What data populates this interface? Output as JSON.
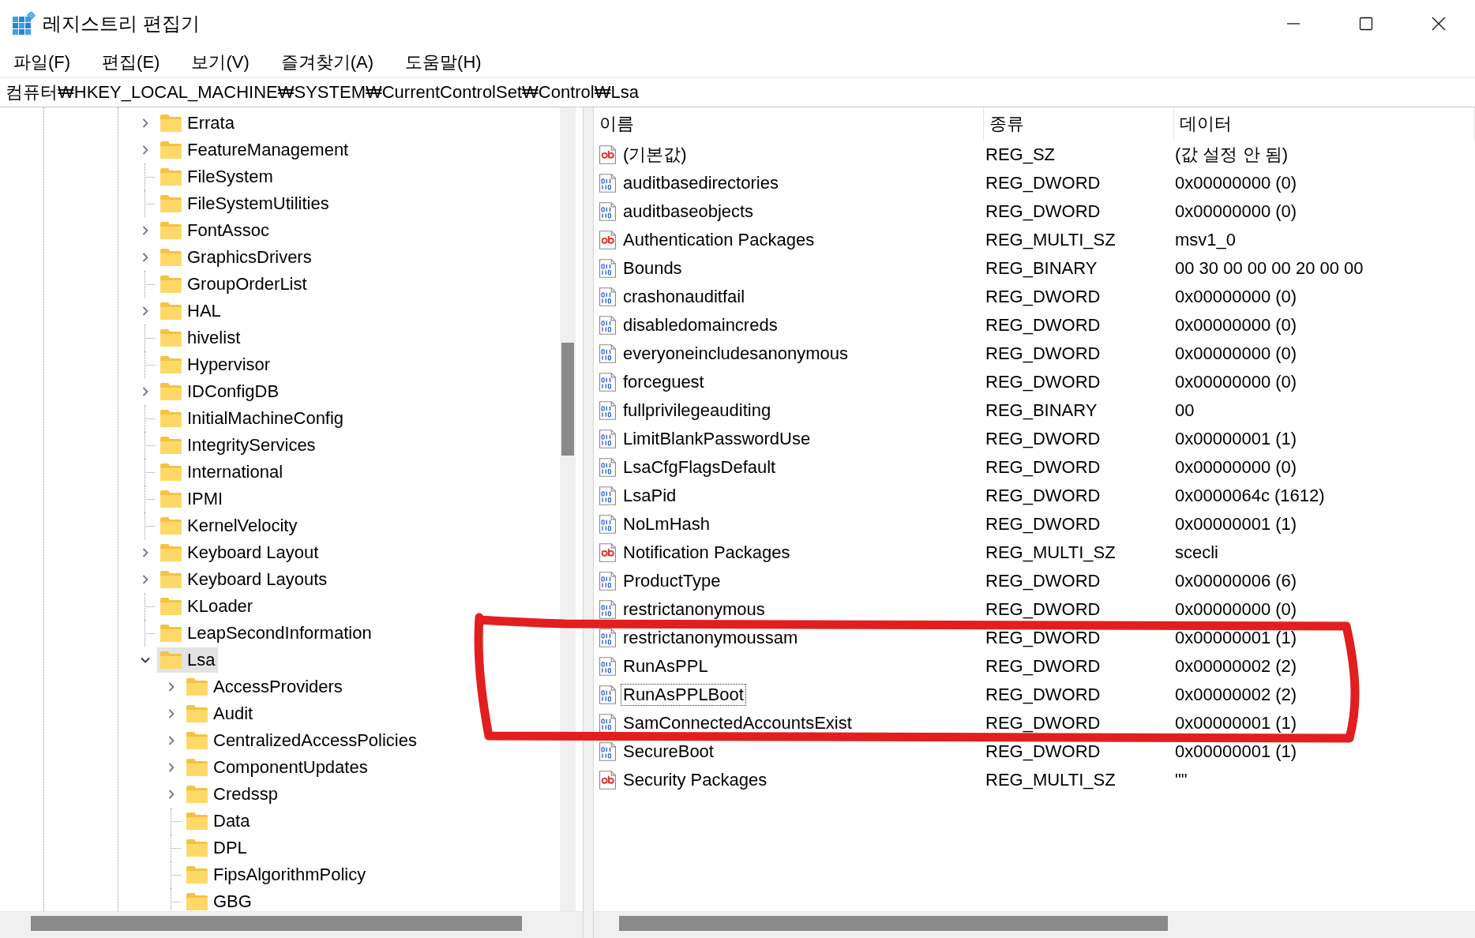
{
  "window": {
    "title": "레지스트리 편집기"
  },
  "menu": [
    "파일(F)",
    "편집(E)",
    "보기(V)",
    "즐겨찾기(A)",
    "도움말(H)"
  ],
  "address": "컴퓨터₩HKEY_LOCAL_MACHINE₩SYSTEM₩CurrentControlSet₩Control₩Lsa",
  "tree": [
    {
      "name": "Errata",
      "kind": "branch",
      "expanded": false,
      "selected": false
    },
    {
      "name": "FeatureManagement",
      "kind": "branch",
      "expanded": false,
      "selected": false
    },
    {
      "name": "FileSystem",
      "kind": "leaf",
      "selected": false
    },
    {
      "name": "FileSystemUtilities",
      "kind": "leaf",
      "selected": false
    },
    {
      "name": "FontAssoc",
      "kind": "branch",
      "expanded": false,
      "selected": false
    },
    {
      "name": "GraphicsDrivers",
      "kind": "branch",
      "expanded": false,
      "selected": false
    },
    {
      "name": "GroupOrderList",
      "kind": "leaf",
      "selected": false
    },
    {
      "name": "HAL",
      "kind": "branch",
      "expanded": false,
      "selected": false
    },
    {
      "name": "hivelist",
      "kind": "leaf",
      "selected": false
    },
    {
      "name": "Hypervisor",
      "kind": "leaf",
      "selected": false
    },
    {
      "name": "IDConfigDB",
      "kind": "branch",
      "expanded": false,
      "selected": false
    },
    {
      "name": "InitialMachineConfig",
      "kind": "leaf",
      "selected": false
    },
    {
      "name": "IntegrityServices",
      "kind": "leaf",
      "selected": false
    },
    {
      "name": "International",
      "kind": "leaf",
      "selected": false
    },
    {
      "name": "IPMI",
      "kind": "leaf",
      "selected": false
    },
    {
      "name": "KernelVelocity",
      "kind": "leaf",
      "selected": false
    },
    {
      "name": "Keyboard Layout",
      "kind": "branch",
      "expanded": false,
      "selected": false
    },
    {
      "name": "Keyboard Layouts",
      "kind": "branch",
      "expanded": false,
      "selected": false
    },
    {
      "name": "KLoader",
      "kind": "leaf",
      "selected": false
    },
    {
      "name": "LeapSecondInformation",
      "kind": "leaf",
      "selected": false
    },
    {
      "name": "Lsa",
      "kind": "branch",
      "expanded": true,
      "selected": true,
      "children": [
        {
          "name": "AccessProviders",
          "kind": "branch",
          "expanded": false,
          "selected": false
        },
        {
          "name": "Audit",
          "kind": "branch",
          "expanded": false,
          "selected": false
        },
        {
          "name": "CentralizedAccessPolicies",
          "kind": "branch",
          "expanded": false,
          "selected": false
        },
        {
          "name": "ComponentUpdates",
          "kind": "branch",
          "expanded": false,
          "selected": false
        },
        {
          "name": "Credssp",
          "kind": "branch",
          "expanded": false,
          "selected": false
        },
        {
          "name": "Data",
          "kind": "leaf",
          "selected": false
        },
        {
          "name": "DPL",
          "kind": "leaf",
          "selected": false
        },
        {
          "name": "FipsAlgorithmPolicy",
          "kind": "leaf",
          "selected": false
        },
        {
          "name": "GBG",
          "kind": "leaf",
          "selected": false
        }
      ]
    }
  ],
  "list": {
    "columns": [
      "이름",
      "종류",
      "데이터"
    ],
    "rows": [
      {
        "kind": "string",
        "name": "(기본값)",
        "type": "REG_SZ",
        "data": "(값 설정 안 됨)",
        "focused": false
      },
      {
        "kind": "binary",
        "name": "auditbasedirectories",
        "type": "REG_DWORD",
        "data": "0x00000000 (0)",
        "focused": false
      },
      {
        "kind": "binary",
        "name": "auditbaseobjects",
        "type": "REG_DWORD",
        "data": "0x00000000 (0)",
        "focused": false
      },
      {
        "kind": "string",
        "name": "Authentication Packages",
        "type": "REG_MULTI_SZ",
        "data": "msv1_0",
        "focused": false
      },
      {
        "kind": "binary",
        "name": "Bounds",
        "type": "REG_BINARY",
        "data": "00 30 00 00 00 20 00 00",
        "focused": false
      },
      {
        "kind": "binary",
        "name": "crashonauditfail",
        "type": "REG_DWORD",
        "data": "0x00000000 (0)",
        "focused": false
      },
      {
        "kind": "binary",
        "name": "disabledomaincreds",
        "type": "REG_DWORD",
        "data": "0x00000000 (0)",
        "focused": false
      },
      {
        "kind": "binary",
        "name": "everyoneincludesanonymous",
        "type": "REG_DWORD",
        "data": "0x00000000 (0)",
        "focused": false
      },
      {
        "kind": "binary",
        "name": "forceguest",
        "type": "REG_DWORD",
        "data": "0x00000000 (0)",
        "focused": false
      },
      {
        "kind": "binary",
        "name": "fullprivilegeauditing",
        "type": "REG_BINARY",
        "data": "00",
        "focused": false
      },
      {
        "kind": "binary",
        "name": "LimitBlankPasswordUse",
        "type": "REG_DWORD",
        "data": "0x00000001 (1)",
        "focused": false
      },
      {
        "kind": "binary",
        "name": "LsaCfgFlagsDefault",
        "type": "REG_DWORD",
        "data": "0x00000000 (0)",
        "focused": false
      },
      {
        "kind": "binary",
        "name": "LsaPid",
        "type": "REG_DWORD",
        "data": "0x0000064c (1612)",
        "focused": false
      },
      {
        "kind": "binary",
        "name": "NoLmHash",
        "type": "REG_DWORD",
        "data": "0x00000001 (1)",
        "focused": false
      },
      {
        "kind": "string",
        "name": "Notification Packages",
        "type": "REG_MULTI_SZ",
        "data": "scecli",
        "focused": false
      },
      {
        "kind": "binary",
        "name": "ProductType",
        "type": "REG_DWORD",
        "data": "0x00000006 (6)",
        "focused": false
      },
      {
        "kind": "binary",
        "name": "restrictanonymous",
        "type": "REG_DWORD",
        "data": "0x00000000 (0)",
        "focused": false
      },
      {
        "kind": "binary",
        "name": "restrictanonymoussam",
        "type": "REG_DWORD",
        "data": "0x00000001 (1)",
        "focused": false
      },
      {
        "kind": "binary",
        "name": "RunAsPPL",
        "type": "REG_DWORD",
        "data": "0x00000002 (2)",
        "focused": false
      },
      {
        "kind": "binary",
        "name": "RunAsPPLBoot",
        "type": "REG_DWORD",
        "data": "0x00000002 (2)",
        "focused": true
      },
      {
        "kind": "binary",
        "name": "SamConnectedAccountsExist",
        "type": "REG_DWORD",
        "data": "0x00000001 (1)",
        "focused": false
      },
      {
        "kind": "binary",
        "name": "SecureBoot",
        "type": "REG_DWORD",
        "data": "0x00000001 (1)",
        "focused": false
      },
      {
        "kind": "string",
        "name": "Security Packages",
        "type": "REG_MULTI_SZ",
        "data": "\"\"",
        "focused": false
      }
    ]
  }
}
